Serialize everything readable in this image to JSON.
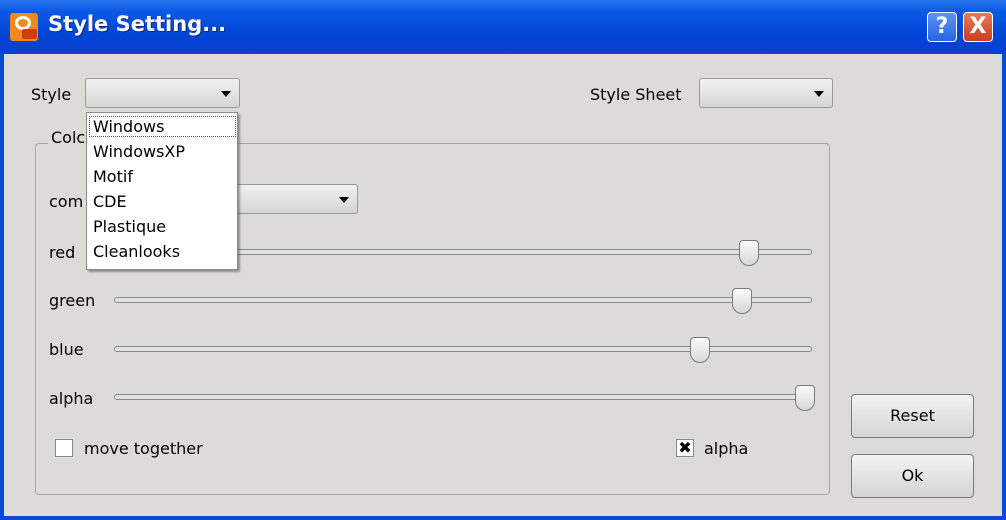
{
  "window": {
    "title": "Style Setting..."
  },
  "titlebar": {
    "help_glyph": "?",
    "close_glyph": "X"
  },
  "style": {
    "label": "Style",
    "value": "",
    "options": [
      "Windows",
      "WindowsXP",
      "Motif",
      "CDE",
      "Plastique",
      "Cleanlooks"
    ]
  },
  "stylesheet": {
    "label": "Style Sheet",
    "value": ""
  },
  "group": {
    "title": "Colc"
  },
  "component": {
    "label": "com",
    "value": ""
  },
  "sliders": [
    {
      "label": "red",
      "value": 0.91
    },
    {
      "label": "green",
      "value": 0.9
    },
    {
      "label": "blue",
      "value": 0.84
    },
    {
      "label": "alpha",
      "value": 0.99
    }
  ],
  "move_together": {
    "label": "move together",
    "checked": false
  },
  "alpha_check": {
    "label": "alpha",
    "checked": true,
    "mark": "✖"
  },
  "buttons": {
    "reset": "Reset",
    "ok": "Ok"
  },
  "colors": {
    "title_bar": "#0046d8",
    "dialog_bg": "#dcdbd8"
  },
  "icons": [
    "app-icon",
    "help-icon",
    "close-icon",
    "chevron-down-icon",
    "checkbox-icon"
  ]
}
